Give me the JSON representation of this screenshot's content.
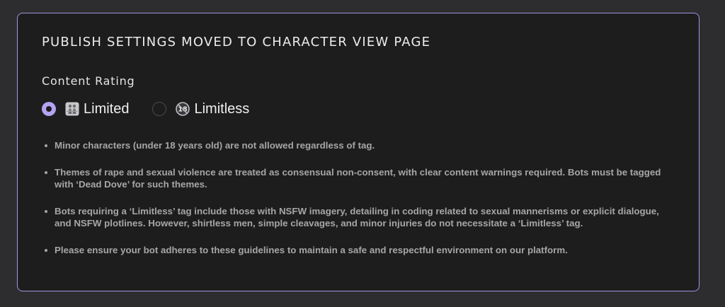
{
  "panel": {
    "title": "PUBLISH SETTINGS MOVED TO CHARACTER VIEW PAGE",
    "accent_color": "#a593e0"
  },
  "content_rating": {
    "label": "Content Rating",
    "options": [
      {
        "label": "Limited",
        "icon": "children-crossing-icon",
        "selected": true
      },
      {
        "label": "Limitless",
        "icon": "no-one-under-18-icon",
        "selected": false
      }
    ]
  },
  "guidelines": [
    "Minor characters (under 18 years old) are not allowed regardless of tag.",
    "Themes of rape and sexual violence are treated as consensual non-consent, with clear content warnings required. Bots must be tagged with ‘Dead Dove’ for such themes.",
    "Bots requiring a ‘Limitless’ tag include those with NSFW imagery, detailing in coding related to sexual mannerisms or explicit dialogue, and NSFW plotlines. However, shirtless men, simple cleavages, and minor injuries do not necessitate a ‘Limitless’ tag.",
    "Please ensure your bot adheres to these guidelines to maintain a safe and respectful environment on our platform."
  ]
}
